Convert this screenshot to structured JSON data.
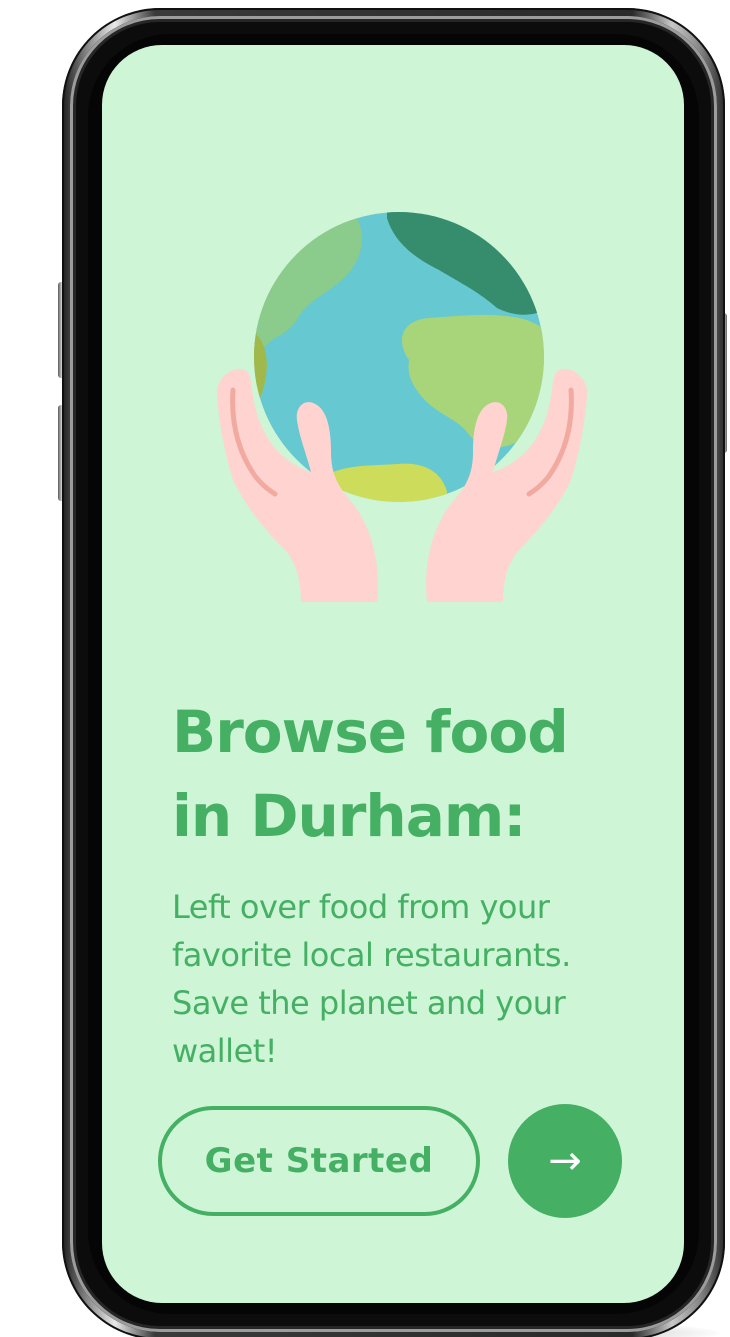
{
  "onboarding": {
    "headline_line1": "Browse food",
    "headline_line2": "in Durham:",
    "description": "Left over food from your favorite local restaurants. Save the planet and your wallet!",
    "primary_button_label": "Get Started",
    "next_button_icon": "arrow-right-icon",
    "next_button_glyph": "→"
  },
  "theme": {
    "background": "#cdf5d6",
    "accent": "#45b063",
    "button_text_on_accent": "#ffffff"
  },
  "illustration": {
    "icon": "earth-in-hands-icon"
  }
}
